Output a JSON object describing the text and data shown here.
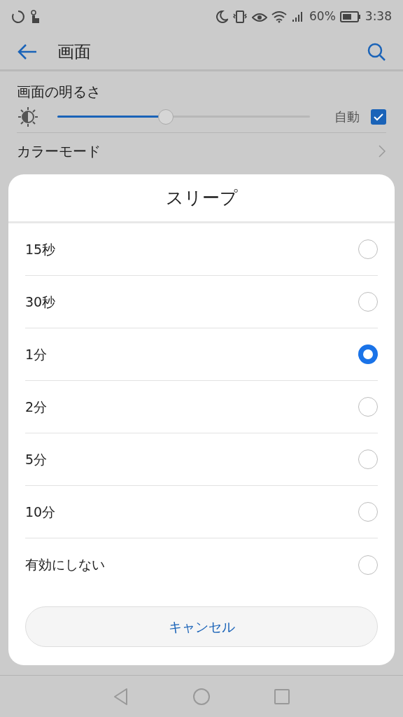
{
  "status_bar": {
    "battery": "60%",
    "time": "3:38"
  },
  "header": {
    "title": "画面"
  },
  "brightness": {
    "title": "画面の明るさ",
    "level": 0.43,
    "auto_label": "自動",
    "auto_checked": true
  },
  "rows": [
    {
      "label": "カラーモード"
    }
  ],
  "dialog": {
    "title": "スリープ",
    "options": [
      {
        "label": "15秒",
        "selected": false
      },
      {
        "label": "30秒",
        "selected": false
      },
      {
        "label": "1分",
        "selected": true
      },
      {
        "label": "2分",
        "selected": false
      },
      {
        "label": "5分",
        "selected": false
      },
      {
        "label": "10分",
        "selected": false
      },
      {
        "label": "有効にしない",
        "selected": false
      }
    ],
    "cancel": "キャンセル"
  }
}
